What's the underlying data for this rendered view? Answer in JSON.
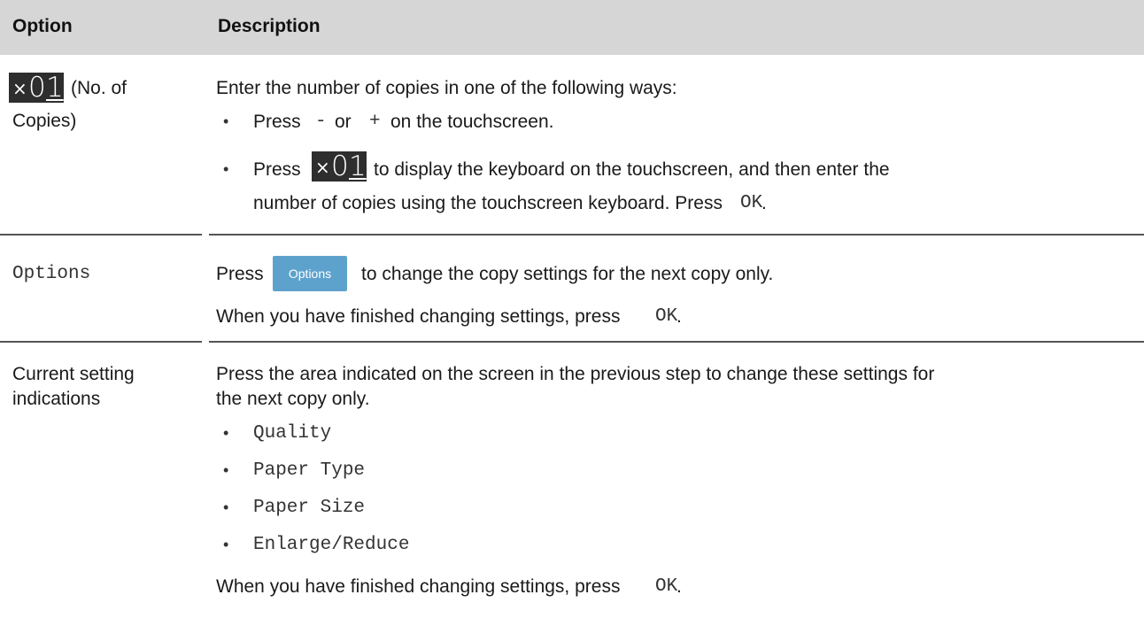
{
  "header": {
    "option": "Option",
    "description": "Description"
  },
  "row1": {
    "badge": {
      "times": "×",
      "digit1": "0",
      "digit2": "1"
    },
    "option_label_line1": "(No. of",
    "option_label_line2": "Copies)",
    "intro": "Enter the number of copies in one of the following ways:",
    "bullet1": {
      "pre": "Press",
      "minus": "-",
      "or": "or",
      "plus": "+",
      "post": "on the touchscreen."
    },
    "bullet2": {
      "pre": "Press",
      "post": "to display the keyboard on the touchscreen, and then enter the",
      "line2_pre": "number of copies using the touchscreen keyboard. Press",
      "ok": "OK",
      "dot": "."
    }
  },
  "row2": {
    "option": "Options",
    "line1_pre": "Press",
    "button_label": "Options",
    "line1_post": "to change the copy settings for the next copy only.",
    "line2_pre": "When you have finished changing settings, press",
    "ok": "OK",
    "dot": "."
  },
  "row3": {
    "option_line1": "Current setting",
    "option_line2": "indications",
    "desc_line1": "Press the area indicated on the screen in the previous step to change these settings for",
    "desc_line2": "the next copy only.",
    "items": [
      "Quality",
      "Paper Type",
      "Paper Size",
      "Enlarge/Reduce"
    ],
    "final_pre": "When you have finished changing settings, press",
    "ok": "OK",
    "dot": "."
  },
  "bullet_char": "•"
}
